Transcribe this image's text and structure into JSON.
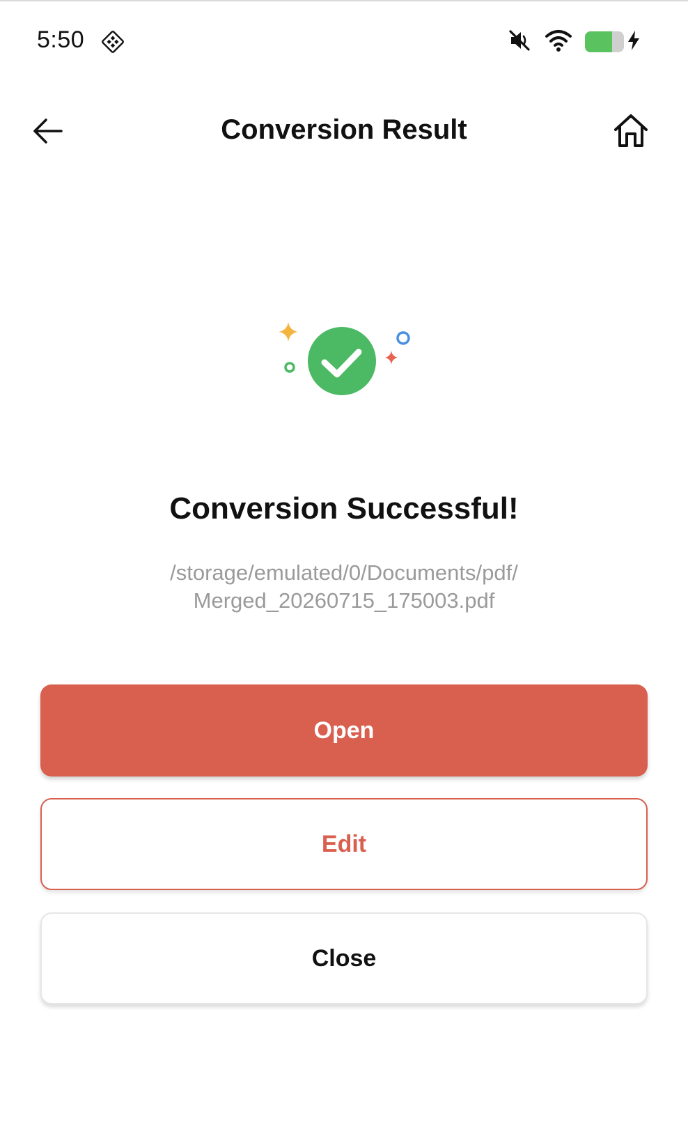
{
  "status_bar": {
    "time": "5:50",
    "app_icon": "diamond-grid-icon",
    "mute_icon": "volume-muted-icon",
    "wifi_icon": "wifi-icon",
    "battery_icon": "battery-charging-icon",
    "battery_level": 0.7
  },
  "app_bar": {
    "title": "Conversion Result",
    "back_icon": "back-arrow-icon",
    "home_icon": "home-icon"
  },
  "result": {
    "icon": "success-check-icon",
    "heading": "Conversion Successful!",
    "path_line1": "/storage/emulated/0/Documents/pdf/",
    "path_line2": "Merged_20260715_175003.pdf"
  },
  "actions": {
    "open_label": "Open",
    "edit_label": "Edit",
    "close_label": "Close"
  },
  "colors": {
    "accent": "#d95f4f",
    "success": "#4cb964",
    "sparkle_yellow": "#f3b53f",
    "sparkle_red": "#e8634f",
    "sparkle_blue": "#4a90e2",
    "sparkle_green": "#4cb964",
    "path_text": "#9a9a9a"
  }
}
